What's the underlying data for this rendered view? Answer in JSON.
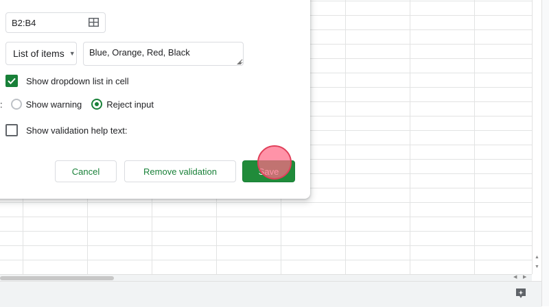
{
  "dialog": {
    "range": {
      "value": "B2:B4",
      "icon": "grid-select-icon"
    },
    "criteria": {
      "type_label": "List of items",
      "items_value": "Blue, Orange, Red, Black"
    },
    "show_dropdown": {
      "label": "Show dropdown list in cell",
      "checked": true
    },
    "on_invalid": {
      "prefix": ":",
      "options": [
        {
          "label": "Show warning",
          "selected": false
        },
        {
          "label": "Reject input",
          "selected": true
        }
      ]
    },
    "help_text": {
      "label": "Show validation help text:",
      "checked": false
    },
    "buttons": {
      "cancel": "Cancel",
      "remove": "Remove validation",
      "save": "Save"
    }
  },
  "colors": {
    "accent": "#188038",
    "save_bg": "#208b3a",
    "cursor": "#ff6987"
  }
}
